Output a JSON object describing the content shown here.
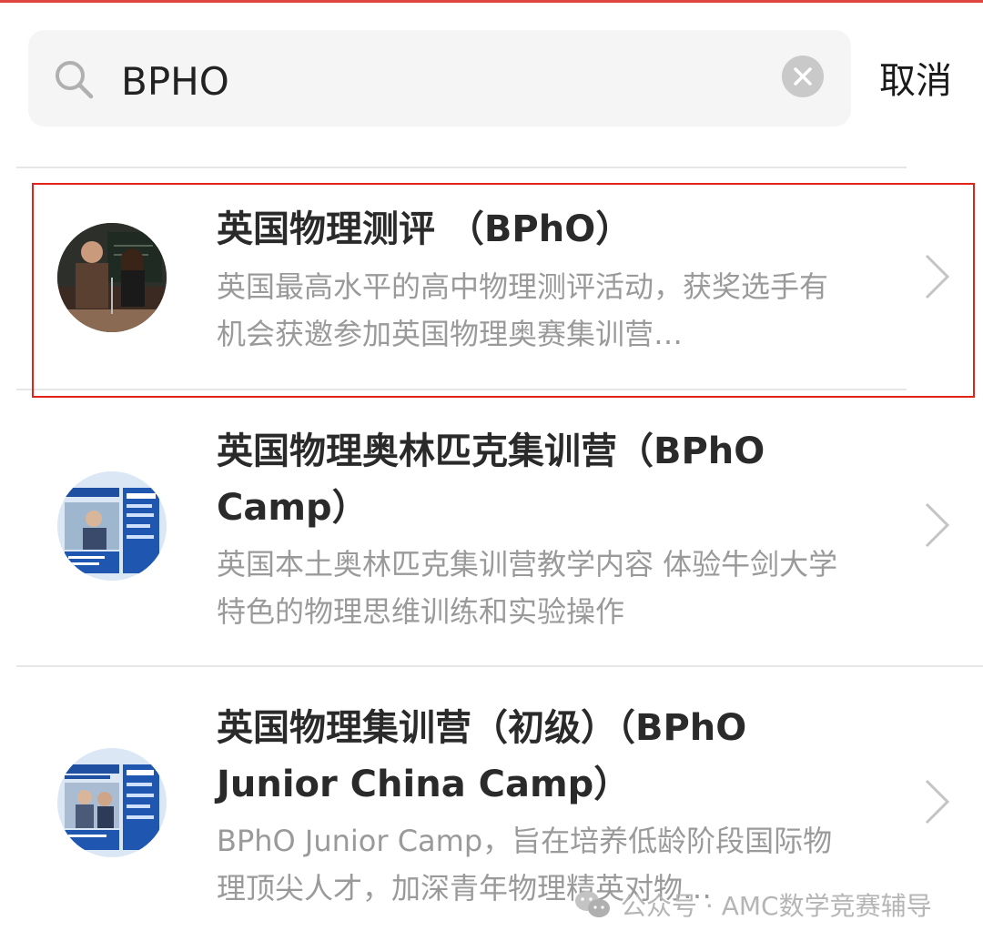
{
  "search": {
    "value": "BPHO",
    "cancel_label": "取消"
  },
  "results": [
    {
      "title": "英国物理测评 （BPhO）",
      "description": "英国最高水平的高中物理测评活动，获奖选手有机会获邀参加英国物理奥赛集训营…",
      "highlighted": true
    },
    {
      "title": "英国物理奥林匹克集训营（BPhO Camp）",
      "description": "英国本土奥林匹克集训营教学内容 体验牛剑大学特色的物理思维训练和实验操作",
      "highlighted": false
    },
    {
      "title": "英国物理集训营（初级）（BPhO Junior China Camp）",
      "description": "BPhO Junior Camp，旨在培养低龄阶段国际物理顶尖人才，加深青年物理精英对物…",
      "highlighted": false
    }
  ],
  "watermark": "公众号 · AMC数学竞赛辅导",
  "colors": {
    "highlight_border": "#e2231a",
    "search_bg": "#f5f5f5"
  }
}
